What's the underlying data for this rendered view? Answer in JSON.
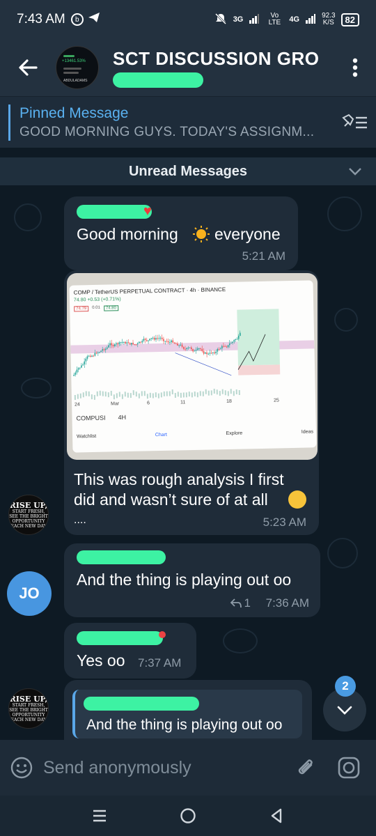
{
  "status_bar": {
    "time": "7:43 AM",
    "network": "3G",
    "volte": "Vo LTE",
    "network2": "4G",
    "speed_value": "92.3",
    "speed_unit": "K/S",
    "battery": "82"
  },
  "header": {
    "title": "SCT DISCUSSION GRO",
    "avatar_lines": [
      "+13461.53%",
      "ABDULADAMS"
    ]
  },
  "pinned": {
    "title": "Pinned Message",
    "message": "GOOD MORNING GUYS.  TODAY'S ASSIGNM..."
  },
  "chat": {
    "unread_label": "Unread Messages",
    "messages": [
      {
        "text_a": "Good morning",
        "text_b": "everyone",
        "time": "5:21 AM"
      },
      {
        "chart_title": "COMP / TetherUS PERPETUAL CONTRACT · 4h · BINANCE",
        "chart_price": "74.80 +0.53 (+0.71%)",
        "chart_box1": "74.79",
        "chart_box2": "0.01",
        "chart_box3": "74.80",
        "chart_axis": [
          "24",
          "Mar",
          "6",
          "11",
          "18",
          "25"
        ],
        "chart_symbol": "COMPUSI",
        "chart_interval": "4H",
        "chart_nav": [
          "Watchlist",
          "Chart",
          "Explore",
          "Ideas"
        ],
        "text_line1": "This was rough analysis I first",
        "text_line2": "did and wasn’t sure of at all",
        "text_dots": "....",
        "time": "5:23 AM"
      },
      {
        "text": "And the thing is playing out oo",
        "reply_count": "1",
        "time": "7:36 AM"
      },
      {
        "text": "Yes oo",
        "time": "7:37 AM"
      },
      {
        "quote": "And the thing is playing out oo"
      }
    ],
    "avatars": {
      "rise_line1": "RISE UP,",
      "rise_line2": "START FRESH,",
      "rise_line3": "SEE THE BRIGHT",
      "rise_line4": "OPPORTUNITY",
      "rise_line5": "EACH NEW DAY",
      "jo": "JO"
    },
    "scroll_badge": "2"
  },
  "composer": {
    "placeholder": "Send anonymously"
  },
  "colors": {
    "accent": "#5aa7e8",
    "bubble": "#1f2c39",
    "redaction": "#3df2a3"
  }
}
